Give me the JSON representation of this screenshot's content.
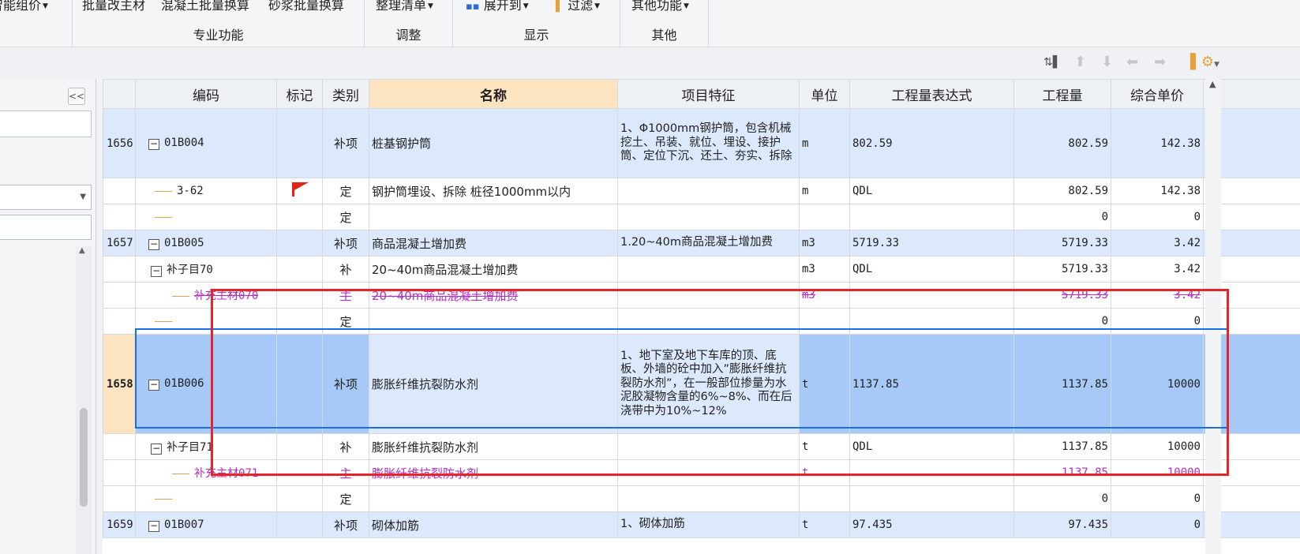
{
  "ribbon": {
    "btn_smart_price": "智能组价",
    "btn_batch_main": "批量改主材",
    "btn_concrete": "混凝土批量换算",
    "btn_mortar": "砂浆批量换算",
    "group_pro": "专业功能",
    "btn_organize": "整理清单",
    "group_adjust": "调整",
    "btn_expand": "展开到",
    "btn_filter": "过滤",
    "group_display": "显示",
    "btn_other": "其他功能",
    "group_other": "其他"
  },
  "left_panel": {
    "collapse_label": "<<"
  },
  "columns": [
    "编码",
    "标记",
    "类别",
    "名称",
    "项目特征",
    "单位",
    "工程量表达式",
    "工程量",
    "综合单价"
  ],
  "rows": [
    {
      "num": "1656",
      "code": "01B004",
      "mark": "",
      "type": "补项",
      "name": "桩基钢护筒",
      "feature": "1、Φ1000mm钢护筒，包含机械挖土、吊装、就位、埋设、接护筒、定位下沉、还土、夯实、拆除",
      "unit": "m",
      "expr": "802.59",
      "qty": "802.59",
      "price": "142.38"
    },
    {
      "num": "",
      "code": "3-62",
      "mark": "flag",
      "type": "定",
      "name": "钢护筒埋设、拆除 桩径1000mm以内",
      "feature": "",
      "unit": "m",
      "expr": "QDL",
      "qty": "802.59",
      "price": "142.38"
    },
    {
      "num": "",
      "code": "",
      "mark": "",
      "type": "定",
      "name": "",
      "feature": "",
      "unit": "",
      "expr": "",
      "qty": "0",
      "price": "0"
    },
    {
      "num": "1657",
      "code": "01B005",
      "mark": "",
      "type": "补项",
      "name": "商品混凝土增加费",
      "feature": "1.20~40m商品混凝土增加费",
      "unit": "m3",
      "expr": "5719.33",
      "qty": "5719.33",
      "price": "3.42"
    },
    {
      "num": "",
      "code": "补子目70",
      "mark": "",
      "type": "补",
      "name": "20~40m商品混凝土增加费",
      "feature": "",
      "unit": "m3",
      "expr": "QDL",
      "qty": "5719.33",
      "price": "3.42"
    },
    {
      "num": "",
      "code": "补充主材070",
      "mark": "",
      "type": "主",
      "name": "20~40m商品混凝土增加费",
      "feature": "",
      "unit": "m3",
      "expr": "",
      "qty": "5719.33",
      "price": "3.42"
    },
    {
      "num": "",
      "code": "",
      "mark": "",
      "type": "定",
      "name": "",
      "feature": "",
      "unit": "",
      "expr": "",
      "qty": "0",
      "price": "0"
    },
    {
      "num": "1658",
      "code": "01B006",
      "mark": "",
      "type": "补项",
      "name": "膨胀纤维抗裂防水剂",
      "feature": "1、地下室及地下车库的顶、底板、外墙的砼中加入”膨胀纤维抗裂防水剂”，在一般部位掺量为水泥胶凝物含量的6%~8%、而在后浇带中为10%~12%",
      "unit": "t",
      "expr": "1137.85",
      "qty": "1137.85",
      "price": "10000"
    },
    {
      "num": "",
      "code": "补子目71",
      "mark": "",
      "type": "补",
      "name": "膨胀纤维抗裂防水剂",
      "feature": "",
      "unit": "t",
      "expr": "QDL",
      "qty": "1137.85",
      "price": "10000"
    },
    {
      "num": "",
      "code": "补充主材071",
      "mark": "",
      "type": "主",
      "name": "膨胀纤维抗裂防水剂",
      "feature": "",
      "unit": "t",
      "expr": "",
      "qty": "1137.85",
      "price": "10000"
    },
    {
      "num": "",
      "code": "",
      "mark": "",
      "type": "定",
      "name": "",
      "feature": "",
      "unit": "",
      "expr": "",
      "qty": "0",
      "price": "0"
    },
    {
      "num": "1659",
      "code": "01B007",
      "mark": "",
      "type": "补项",
      "name": "砌体加筋",
      "feature": "1、砌体加筋",
      "unit": "t",
      "expr": "97.435",
      "qty": "97.435",
      "price": "0"
    }
  ],
  "colors": {
    "accent": "#1a6fe8",
    "highlight_box": "#e8232a",
    "material_text": "#b12fc2",
    "selected_row": "#a6c9f7"
  }
}
